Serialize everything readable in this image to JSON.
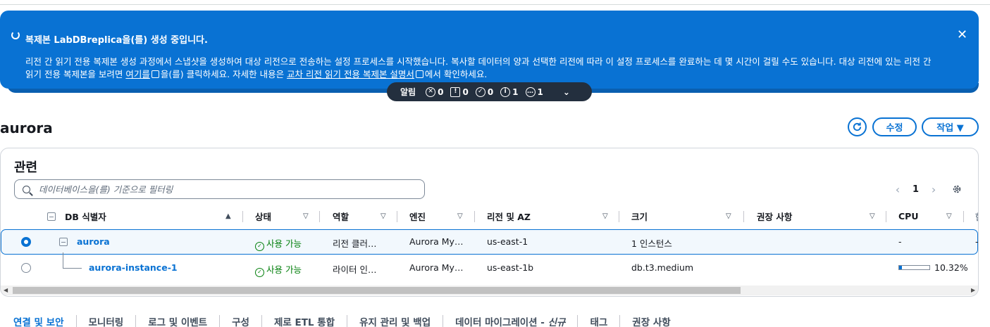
{
  "flash": {
    "title": "복제본 LabDBreplica을(를) 생성 중입니다.",
    "body_part1": "리전 간 읽기 전용 복제본 생성 과정에서 스냅샷을 생성하여 대상 리전으로 전송하는 설정 프로세스를 시작했습니다. 복사할 데이터의 양과 선택한 리전에 따라 이 설정 프로세스를 완료하는 데 몇 시간이 걸릴 수도 있습니다. 대상 리전에 있는 리전 간 읽기 전용 복제본을 보려면 ",
    "link1": "여기를",
    "body_part2": "을(를) 클릭하세요. 자세한 내용은 ",
    "link2": "교차 리전 읽기 전용 복제본 설명서",
    "body_part3": "에서 확인하세요.",
    "close": "✕"
  },
  "notifications": {
    "label": "알림",
    "error": "0",
    "warning": "0",
    "success": "0",
    "info": "1",
    "in_progress": "1"
  },
  "header": {
    "title": "aurora",
    "edit": "수정",
    "actions": "작업 ▼"
  },
  "panel": {
    "title": "관련",
    "filter_placeholder": "데이터베이스을(를) 기준으로 필터링",
    "page": "1"
  },
  "columns": [
    "DB 식별자",
    "상태",
    "역할",
    "엔진",
    "리전 및 AZ",
    "크기",
    "권장 사항",
    "CPU"
  ],
  "rows": [
    {
      "id": "aurora",
      "status": "사용 가능",
      "role": "리전 클러…",
      "engine": "Aurora My…",
      "region": "us-east-1",
      "size": "1 인스턴스",
      "recommend": "",
      "cpu": "-",
      "extra": "-"
    },
    {
      "id": "aurora-instance-1",
      "status": "사용 가능",
      "role": "라이터 인…",
      "engine": "Aurora My…",
      "region": "us-east-1b",
      "size": "db.t3.medium",
      "recommend": "",
      "cpu": "10.32%",
      "cpu_fraction": 0.1032
    }
  ],
  "tabs": [
    "연결 및 보안",
    "모니터링",
    "로그 및 이벤트",
    "구성",
    "제로 ETL 통합",
    "유지 관리 및 백업",
    "데이터 마이그레이션 - ",
    "태그",
    "권장 사항"
  ],
  "tab_new": "신규",
  "colors": {
    "accent": "#0972d3",
    "success": "#037f0c",
    "banner": "#0972d3",
    "notif": "#232f3e"
  }
}
